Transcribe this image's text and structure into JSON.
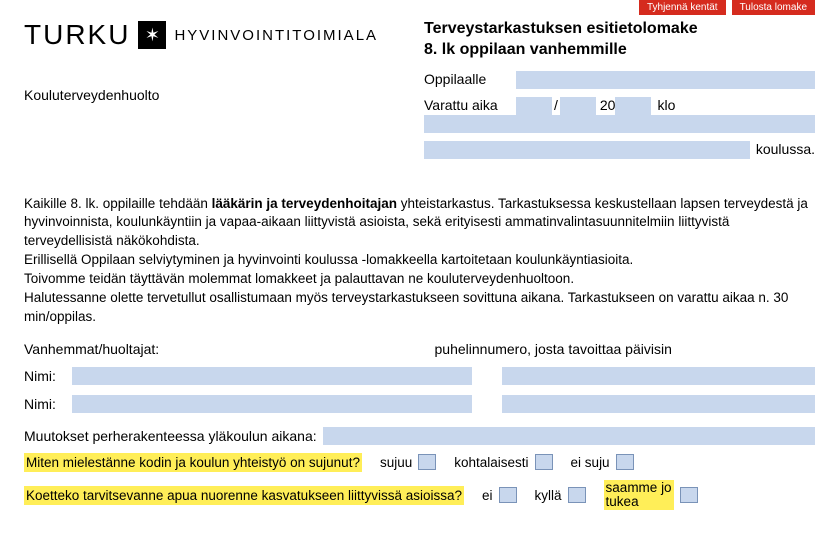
{
  "top_buttons": {
    "clear": "Tyhjennä kentät",
    "print": "Tulosta lomake"
  },
  "header": {
    "turku": "TURKU",
    "hyvin": "HYVINVOINTITOIMIALA",
    "title_l1": "Terveystarkastuksen esitietolomake",
    "title_l2": "8. lk oppilaan vanhemmille"
  },
  "koulu_label": "Kouluterveydenhuolto",
  "student": {
    "label": "Oppilaalle",
    "value": "",
    "time_label": "Varattu aika",
    "day": "",
    "month": "",
    "year_prefix": "20",
    "year_suffix": "",
    "slash": "/",
    "klo_label": "klo",
    "klo": "",
    "school": "",
    "school_suffix": "koulussa."
  },
  "intro": {
    "p1a": "Kaikille 8. lk. oppilaille tehdään ",
    "p1b_bold": "lääkärin ja terveydenhoitajan",
    "p1c": " yhteistarkastus. Tarkastuksessa keskustellaan lapsen terveydestä ja hyvinvoinnista, koulunkäyntiin ja vapaa-aikaan liittyvistä asioista, sekä erityisesti ammatin­valintasuunnitelmiin liittyvistä terveydellisistä näkökohdista.",
    "p2": "Erillisellä Oppilaan selviytyminen ja hyvinvointi koulussa -lomakkeella kartoitetaan koulunkäyntiasioita.",
    "p3": "Toivomme teidän täyttävän molemmat lomakkeet ja palauttavan ne kouluterveydenhuoltoon.",
    "p4": "Halutessanne olette tervetullut osallistumaan myös terveystarkastukseen sovittuna aikana. Tarkastukseen on varattu aikaa n. 30 min/oppilas."
  },
  "parents": {
    "left_label": "Vanhemmat/huoltajat:",
    "right_label": "puhelinnumero, josta tavoittaa päivisin",
    "name_label": "Nimi:",
    "name1": "",
    "phone1": "",
    "name2": "",
    "phone2": ""
  },
  "changes": {
    "label": "Muutokset perherakenteessa yläkoulun aikana:",
    "value": ""
  },
  "q1": {
    "text": "Miten mielestänne kodin ja koulun yhteistyö on sujunut?",
    "opt1": "sujuu",
    "opt2": "kohtalaisesti",
    "opt3": "ei suju"
  },
  "q2": {
    "text": "Koetteko tarvitsevanne apua nuorenne kasvatukseen liittyvissä asioissa?",
    "opt1": "ei",
    "opt2": "kyllä",
    "opt3_l1": "saamme jo",
    "opt3_l2": "tukea"
  }
}
